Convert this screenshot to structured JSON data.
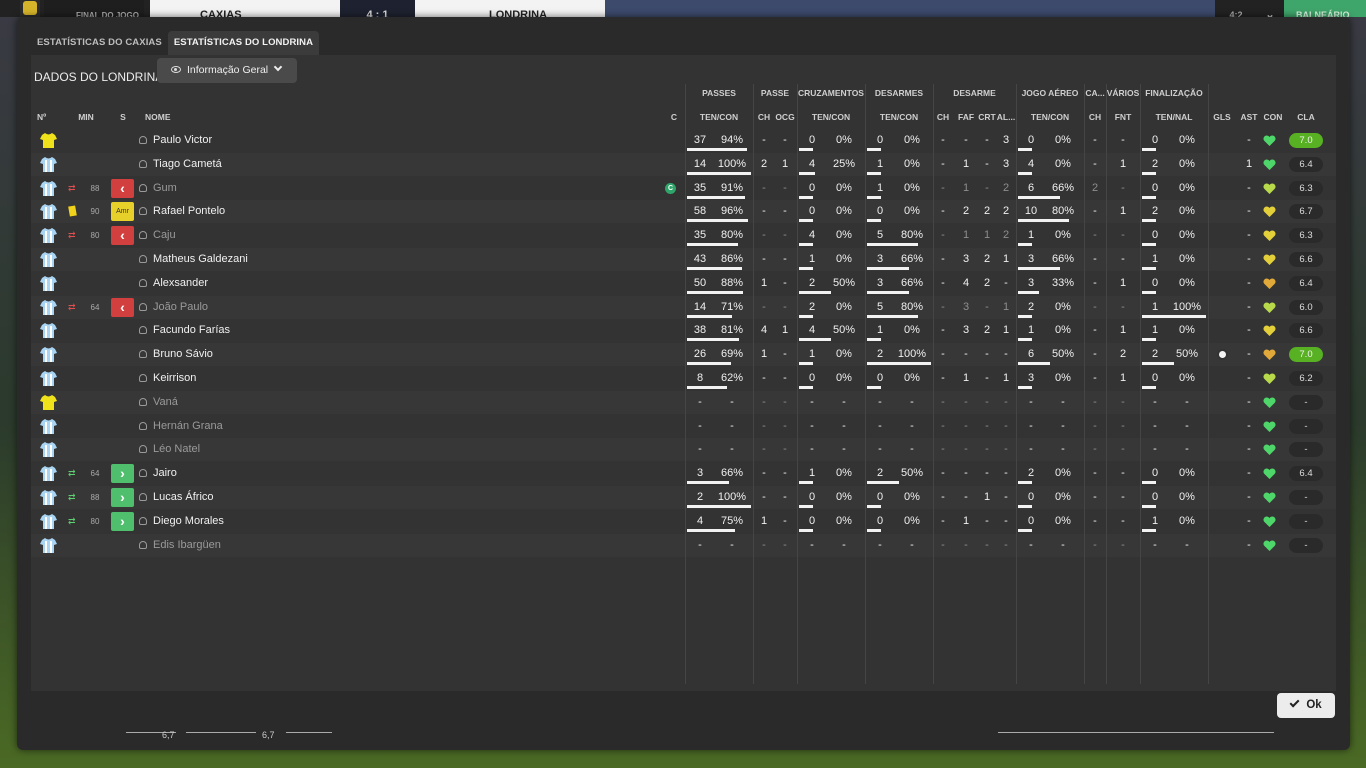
{
  "topbar": {
    "status": "FINAL DO JOGO",
    "home": "CAXIAS",
    "score": "4 : 1",
    "away": "LONDRINA",
    "right_score": "4:2",
    "right_btn": "BALNEÁRIO"
  },
  "tabs": [
    "ESTATÍSTICAS DO CAXIAS",
    "ESTATÍSTICAS DO LONDRINA"
  ],
  "active_tab": 1,
  "panel": {
    "title": "DADOS DO LONDRINA",
    "dropdown": "Informação Geral"
  },
  "groups": [
    "PASSES",
    "PASSE",
    "CRUZAMENTOS",
    "DESARMES",
    "DESARME",
    "JOGO AÉREO",
    "CA...",
    "VÁRIOS",
    "FINALIZAÇÃO"
  ],
  "columns": {
    "num": "Nº",
    "min": "MIN",
    "s": "S",
    "nome": "NOME",
    "c": "C",
    "passes": "TEN/CON",
    "ch1": "CH",
    "ocg": "OCG",
    "cruz": "TEN/CON",
    "des": "TEN/CON",
    "ch2": "CH",
    "faf": "FAF",
    "crt": "CRT",
    "al": "AL...",
    "aereo": "TEN/CON",
    "ch3": "CH",
    "fnt": "FNT",
    "fin": "TEN/NAL",
    "gls": "GLS",
    "ast": "AST",
    "con": "CON",
    "cla": "CLA"
  },
  "players": [
    {
      "name": "Paulo Victor",
      "kit": "gk",
      "sub": "",
      "min": "",
      "badge": "",
      "capt": false,
      "goal": false,
      "dim": false,
      "p": [
        "37",
        "94%"
      ],
      "pbar": 0.94,
      "ch1": "-",
      "ocg": "-",
      "cr": [
        "0",
        "0%"
      ],
      "crbar": 0,
      "de": [
        "0",
        "0%"
      ],
      "debar": 0,
      "ch2": "-",
      "faf": "-",
      "crt": "-",
      "al": "3",
      "ae": [
        "0",
        "0%"
      ],
      "aebar": 0,
      "ch3": "-",
      "fnt": "-",
      "fi": [
        "0",
        "0%"
      ],
      "fibar": 0,
      "gls": "",
      "ast": "-",
      "con": "green",
      "cla": "7.0",
      "hi": true
    },
    {
      "name": "Tiago Cametá",
      "kit": "out",
      "sub": "",
      "min": "",
      "badge": "",
      "capt": false,
      "goal": false,
      "dim": false,
      "p": [
        "14",
        "100%"
      ],
      "pbar": 1,
      "ch1": "2",
      "ocg": "1",
      "cr": [
        "4",
        "25%"
      ],
      "crbar": 0.25,
      "de": [
        "1",
        "0%"
      ],
      "debar": 0,
      "ch2": "-",
      "faf": "1",
      "crt": "-",
      "al": "3",
      "ae": [
        "4",
        "0%"
      ],
      "aebar": 0,
      "ch3": "-",
      "fnt": "1",
      "fi": [
        "2",
        "0%"
      ],
      "fibar": 0,
      "gls": "",
      "ast": "1",
      "con": "green",
      "cla": "6.4",
      "hi": false
    },
    {
      "name": "Gum",
      "kit": "out",
      "sub": "out",
      "min": "88",
      "badge": "red",
      "capt": true,
      "goal": false,
      "dim": true,
      "p": [
        "35",
        "91%"
      ],
      "pbar": 0.91,
      "ch1": "-",
      "ocg": "-",
      "cr": [
        "0",
        "0%"
      ],
      "crbar": 0,
      "de": [
        "1",
        "0%"
      ],
      "debar": 0,
      "ch2": "-",
      "faf": "1",
      "crt": "-",
      "al": "2",
      "ae": [
        "6",
        "66%"
      ],
      "aebar": 0.66,
      "ch3": "2",
      "fnt": "-",
      "fi": [
        "0",
        "0%"
      ],
      "fibar": 0,
      "gls": "",
      "ast": "-",
      "con": "yellowgreen",
      "cla": "6.3",
      "hi": false
    },
    {
      "name": "Rafael Pontelo",
      "kit": "out",
      "sub": "card",
      "min": "90",
      "badge": "amr",
      "capt": false,
      "goal": false,
      "dim": false,
      "p": [
        "58",
        "96%"
      ],
      "pbar": 0.96,
      "ch1": "-",
      "ocg": "-",
      "cr": [
        "0",
        "0%"
      ],
      "crbar": 0,
      "de": [
        "0",
        "0%"
      ],
      "debar": 0,
      "ch2": "-",
      "faf": "2",
      "crt": "2",
      "al": "2",
      "ae": [
        "10",
        "80%"
      ],
      "aebar": 0.8,
      "ch3": "-",
      "fnt": "1",
      "fi": [
        "2",
        "0%"
      ],
      "fibar": 0,
      "gls": "",
      "ast": "-",
      "con": "yellow",
      "cla": "6.7",
      "hi": false
    },
    {
      "name": "Caju",
      "kit": "out",
      "sub": "out",
      "min": "80",
      "badge": "red",
      "capt": false,
      "goal": false,
      "dim": true,
      "p": [
        "35",
        "80%"
      ],
      "pbar": 0.8,
      "ch1": "-",
      "ocg": "-",
      "cr": [
        "4",
        "0%"
      ],
      "crbar": 0,
      "de": [
        "5",
        "80%"
      ],
      "debar": 0.8,
      "ch2": "-",
      "faf": "1",
      "crt": "1",
      "al": "2",
      "ae": [
        "1",
        "0%"
      ],
      "aebar": 0,
      "ch3": "-",
      "fnt": "-",
      "fi": [
        "0",
        "0%"
      ],
      "fibar": 0,
      "gls": "",
      "ast": "-",
      "con": "yellow",
      "cla": "6.3",
      "hi": false
    },
    {
      "name": "Matheus Galdezani",
      "kit": "out",
      "sub": "",
      "min": "",
      "badge": "",
      "capt": false,
      "goal": false,
      "dim": false,
      "p": [
        "43",
        "86%"
      ],
      "pbar": 0.86,
      "ch1": "-",
      "ocg": "-",
      "cr": [
        "1",
        "0%"
      ],
      "crbar": 0,
      "de": [
        "3",
        "66%"
      ],
      "debar": 0.66,
      "ch2": "-",
      "faf": "3",
      "crt": "2",
      "al": "1",
      "ae": [
        "3",
        "66%"
      ],
      "aebar": 0.66,
      "ch3": "-",
      "fnt": "-",
      "fi": [
        "1",
        "0%"
      ],
      "fibar": 0,
      "gls": "",
      "ast": "-",
      "con": "yellow",
      "cla": "6.6",
      "hi": false
    },
    {
      "name": "Alexsander",
      "kit": "out",
      "sub": "",
      "min": "",
      "badge": "",
      "capt": false,
      "goal": false,
      "dim": false,
      "p": [
        "50",
        "88%"
      ],
      "pbar": 0.88,
      "ch1": "1",
      "ocg": "-",
      "cr": [
        "2",
        "50%"
      ],
      "crbar": 0.5,
      "de": [
        "3",
        "66%"
      ],
      "debar": 0.66,
      "ch2": "-",
      "faf": "4",
      "crt": "2",
      "al": "-",
      "ae": [
        "3",
        "33%"
      ],
      "aebar": 0.33,
      "ch3": "-",
      "fnt": "1",
      "fi": [
        "0",
        "0%"
      ],
      "fibar": 0,
      "gls": "",
      "ast": "-",
      "con": "orange",
      "cla": "6.4",
      "hi": false
    },
    {
      "name": "João Paulo",
      "kit": "out",
      "sub": "out",
      "min": "64",
      "badge": "red",
      "capt": false,
      "goal": false,
      "dim": true,
      "p": [
        "14",
        "71%"
      ],
      "pbar": 0.71,
      "ch1": "-",
      "ocg": "-",
      "cr": [
        "2",
        "0%"
      ],
      "crbar": 0,
      "de": [
        "5",
        "80%"
      ],
      "debar": 0.8,
      "ch2": "-",
      "faf": "3",
      "crt": "-",
      "al": "1",
      "ae": [
        "2",
        "0%"
      ],
      "aebar": 0,
      "ch3": "-",
      "fnt": "-",
      "fi": [
        "1",
        "100%"
      ],
      "fibar": 1,
      "gls": "",
      "ast": "-",
      "con": "yellowgreen",
      "cla": "6.0",
      "hi": false
    },
    {
      "name": "Facundo Farías",
      "kit": "out",
      "sub": "",
      "min": "",
      "badge": "",
      "capt": false,
      "goal": false,
      "dim": false,
      "p": [
        "38",
        "81%"
      ],
      "pbar": 0.81,
      "ch1": "4",
      "ocg": "1",
      "cr": [
        "4",
        "50%"
      ],
      "crbar": 0.5,
      "de": [
        "1",
        "0%"
      ],
      "debar": 0,
      "ch2": "-",
      "faf": "3",
      "crt": "2",
      "al": "1",
      "ae": [
        "1",
        "0%"
      ],
      "aebar": 0,
      "ch3": "-",
      "fnt": "1",
      "fi": [
        "1",
        "0%"
      ],
      "fibar": 0,
      "gls": "",
      "ast": "-",
      "con": "yellow",
      "cla": "6.6",
      "hi": false
    },
    {
      "name": "Bruno Sávio",
      "kit": "out",
      "sub": "",
      "min": "",
      "badge": "",
      "capt": false,
      "goal": true,
      "dim": false,
      "p": [
        "26",
        "69%"
      ],
      "pbar": 0.69,
      "ch1": "1",
      "ocg": "-",
      "cr": [
        "1",
        "0%"
      ],
      "crbar": 0,
      "de": [
        "2",
        "100%"
      ],
      "debar": 1,
      "ch2": "-",
      "faf": "-",
      "crt": "-",
      "al": "-",
      "ae": [
        "6",
        "50%"
      ],
      "aebar": 0.5,
      "ch3": "-",
      "fnt": "2",
      "fi": [
        "2",
        "50%"
      ],
      "fibar": 0.5,
      "gls": "",
      "ast": "-",
      "con": "orange",
      "cla": "7.0",
      "hi": true
    },
    {
      "name": "Keirrison",
      "kit": "out",
      "sub": "",
      "min": "",
      "badge": "",
      "capt": false,
      "goal": false,
      "dim": false,
      "p": [
        "8",
        "62%"
      ],
      "pbar": 0.62,
      "ch1": "-",
      "ocg": "-",
      "cr": [
        "0",
        "0%"
      ],
      "crbar": 0,
      "de": [
        "0",
        "0%"
      ],
      "debar": 0,
      "ch2": "-",
      "faf": "1",
      "crt": "-",
      "al": "1",
      "ae": [
        "3",
        "0%"
      ],
      "aebar": 0,
      "ch3": "-",
      "fnt": "1",
      "fi": [
        "0",
        "0%"
      ],
      "fibar": 0,
      "gls": "",
      "ast": "-",
      "con": "yellowgreen",
      "cla": "6.2",
      "hi": false
    },
    {
      "name": "Vaná",
      "kit": "gk",
      "sub": "",
      "min": "",
      "badge": "",
      "capt": false,
      "goal": false,
      "dim": true,
      "p": [
        "-",
        "-"
      ],
      "pbar": 0,
      "ch1": "-",
      "ocg": "-",
      "cr": [
        "-",
        "-"
      ],
      "crbar": 0,
      "de": [
        "-",
        "-"
      ],
      "debar": 0,
      "ch2": "-",
      "faf": "-",
      "crt": "-",
      "al": "-",
      "ae": [
        "-",
        "-"
      ],
      "aebar": 0,
      "ch3": "-",
      "fnt": "-",
      "fi": [
        "-",
        "-"
      ],
      "fibar": 0,
      "gls": "",
      "ast": "-",
      "con": "green",
      "cla": "-",
      "hi": false
    },
    {
      "name": "Hernán Grana",
      "kit": "out",
      "sub": "",
      "min": "",
      "badge": "",
      "capt": false,
      "goal": false,
      "dim": true,
      "p": [
        "-",
        "-"
      ],
      "pbar": 0,
      "ch1": "-",
      "ocg": "-",
      "cr": [
        "-",
        "-"
      ],
      "crbar": 0,
      "de": [
        "-",
        "-"
      ],
      "debar": 0,
      "ch2": "-",
      "faf": "-",
      "crt": "-",
      "al": "-",
      "ae": [
        "-",
        "-"
      ],
      "aebar": 0,
      "ch3": "-",
      "fnt": "-",
      "fi": [
        "-",
        "-"
      ],
      "fibar": 0,
      "gls": "",
      "ast": "-",
      "con": "green",
      "cla": "-",
      "hi": false
    },
    {
      "name": "Léo Natel",
      "kit": "out",
      "sub": "",
      "min": "",
      "badge": "",
      "capt": false,
      "goal": false,
      "dim": true,
      "p": [
        "-",
        "-"
      ],
      "pbar": 0,
      "ch1": "-",
      "ocg": "-",
      "cr": [
        "-",
        "-"
      ],
      "crbar": 0,
      "de": [
        "-",
        "-"
      ],
      "debar": 0,
      "ch2": "-",
      "faf": "-",
      "crt": "-",
      "al": "-",
      "ae": [
        "-",
        "-"
      ],
      "aebar": 0,
      "ch3": "-",
      "fnt": "-",
      "fi": [
        "-",
        "-"
      ],
      "fibar": 0,
      "gls": "",
      "ast": "-",
      "con": "green",
      "cla": "-",
      "hi": false
    },
    {
      "name": "Jairo",
      "kit": "out",
      "sub": "in",
      "min": "64",
      "badge": "green",
      "capt": false,
      "goal": false,
      "dim": false,
      "p": [
        "3",
        "66%"
      ],
      "pbar": 0.66,
      "ch1": "-",
      "ocg": "-",
      "cr": [
        "1",
        "0%"
      ],
      "crbar": 0,
      "de": [
        "2",
        "50%"
      ],
      "debar": 0.5,
      "ch2": "-",
      "faf": "-",
      "crt": "-",
      "al": "-",
      "ae": [
        "2",
        "0%"
      ],
      "aebar": 0,
      "ch3": "-",
      "fnt": "-",
      "fi": [
        "0",
        "0%"
      ],
      "fibar": 0,
      "gls": "",
      "ast": "-",
      "con": "green",
      "cla": "6.4",
      "hi": false
    },
    {
      "name": "Lucas Áfrico",
      "kit": "out",
      "sub": "in",
      "min": "88",
      "badge": "green",
      "capt": false,
      "goal": false,
      "dim": false,
      "p": [
        "2",
        "100%"
      ],
      "pbar": 1,
      "ch1": "-",
      "ocg": "-",
      "cr": [
        "0",
        "0%"
      ],
      "crbar": 0,
      "de": [
        "0",
        "0%"
      ],
      "debar": 0,
      "ch2": "-",
      "faf": "-",
      "crt": "1",
      "al": "-",
      "ae": [
        "0",
        "0%"
      ],
      "aebar": 0,
      "ch3": "-",
      "fnt": "-",
      "fi": [
        "0",
        "0%"
      ],
      "fibar": 0,
      "gls": "",
      "ast": "-",
      "con": "green",
      "cla": "-",
      "hi": false
    },
    {
      "name": "Diego Morales",
      "kit": "out",
      "sub": "in",
      "min": "80",
      "badge": "green",
      "capt": false,
      "goal": false,
      "dim": false,
      "p": [
        "4",
        "75%"
      ],
      "pbar": 0.75,
      "ch1": "1",
      "ocg": "-",
      "cr": [
        "0",
        "0%"
      ],
      "crbar": 0,
      "de": [
        "0",
        "0%"
      ],
      "debar": 0,
      "ch2": "-",
      "faf": "1",
      "crt": "-",
      "al": "-",
      "ae": [
        "0",
        "0%"
      ],
      "aebar": 0,
      "ch3": "-",
      "fnt": "-",
      "fi": [
        "1",
        "0%"
      ],
      "fibar": 0,
      "gls": "",
      "ast": "-",
      "con": "green",
      "cla": "-",
      "hi": false
    },
    {
      "name": "Edis Ibargüen",
      "kit": "out",
      "sub": "",
      "min": "",
      "badge": "",
      "capt": false,
      "goal": false,
      "dim": true,
      "p": [
        "-",
        "-"
      ],
      "pbar": 0,
      "ch1": "-",
      "ocg": "-",
      "cr": [
        "-",
        "-"
      ],
      "crbar": 0,
      "de": [
        "-",
        "-"
      ],
      "debar": 0,
      "ch2": "-",
      "faf": "-",
      "crt": "-",
      "al": "-",
      "ae": [
        "-",
        "-"
      ],
      "aebar": 0,
      "ch3": "-",
      "fnt": "-",
      "fi": [
        "-",
        "-"
      ],
      "fibar": 0,
      "gls": "",
      "ast": "-",
      "con": "green",
      "cla": "-",
      "hi": false
    }
  ],
  "badge_text": {
    "amr": "Amr",
    "capt": "C"
  },
  "ok_label": "Ok",
  "footer": {
    "left_val": "6,7",
    "right_val": "6,7"
  },
  "colors": {
    "green": "#4fd66a",
    "yellowgreen": "#b7d94a",
    "yellow": "#e3cf3a",
    "orange": "#e0a93a",
    "rating_high": "#58b023"
  }
}
